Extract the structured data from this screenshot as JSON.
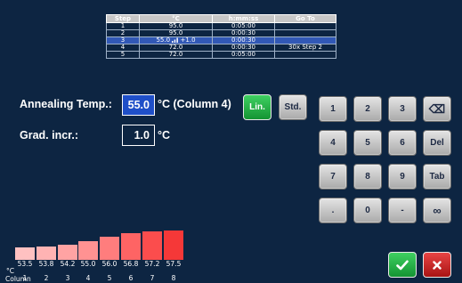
{
  "program_table": {
    "headers": [
      "Step",
      "°C",
      "h:mm:ss",
      "Go To"
    ],
    "rows": [
      {
        "step": "1",
        "temp": "95.0",
        "time": "0:05:00",
        "goto": ""
      },
      {
        "step": "2",
        "temp": "95.0",
        "time": "0:00:30",
        "goto": ""
      },
      {
        "step": "3",
        "temp": "55.0",
        "gradient": "+1.0",
        "time": "0:00:30",
        "goto": "",
        "selected": true
      },
      {
        "step": "4",
        "temp": "72.0",
        "time": "0:00:30",
        "goto": "30x Step 2"
      },
      {
        "step": "5",
        "temp": "72.0",
        "time": "0:05:00",
        "goto": ""
      }
    ]
  },
  "annealing": {
    "label": "Annealing Temp.:",
    "value": "55.0",
    "unit": "°C (Column 4)"
  },
  "gradient_increment": {
    "label": "Grad. incr.:",
    "value": "1.0",
    "unit": "°C"
  },
  "mode_buttons": {
    "linear": "Lin.",
    "standard": "Std."
  },
  "keypad": {
    "keys": [
      "1",
      "2",
      "3",
      "⌫",
      "4",
      "5",
      "6",
      "Del",
      "7",
      "8",
      "9",
      "Tab",
      ".",
      "0",
      "-",
      "∞"
    ]
  },
  "gradient_chart": {
    "unit_label": "°C",
    "column_label": "Column",
    "temperatures": [
      "53.5",
      "53.8",
      "54.2",
      "55.0",
      "56.0",
      "56.8",
      "57.2",
      "57.5"
    ],
    "colors": [
      "#ffc1c1",
      "#ffb3b3",
      "#ffa3a3",
      "#ff9292",
      "#ff7d7d",
      "#fe6464",
      "#fb4d4d",
      "#f53838"
    ],
    "columns": [
      "1",
      "2",
      "3",
      "4",
      "5",
      "6",
      "7",
      "8"
    ]
  },
  "actions": {
    "confirm_icon": "checkmark-icon",
    "cancel_icon": "close-icon"
  }
}
